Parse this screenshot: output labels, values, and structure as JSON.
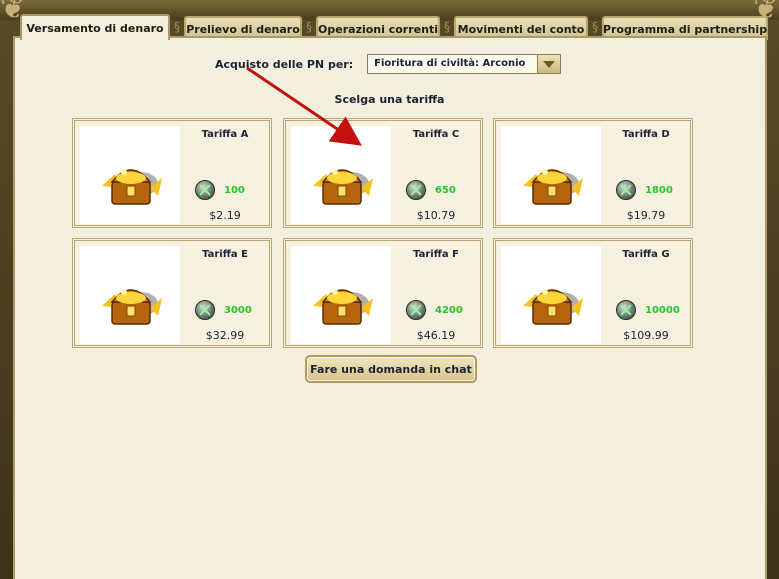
{
  "tabs": [
    {
      "label": "Versamento di denaro",
      "active": true
    },
    {
      "label": "Prelievo di denaro",
      "active": false
    },
    {
      "label": "Operazioni correnti",
      "active": false
    },
    {
      "label": "Movimenti del conto",
      "active": false
    },
    {
      "label": "Programma di partnership",
      "active": false
    }
  ],
  "purchase": {
    "label": "Acquisto delle PN per:",
    "selected": "Fioritura di civiltà: Arconio"
  },
  "choose_title": "Scelga una tariffa",
  "tariffs": [
    {
      "name": "Tariffa A",
      "amount": "100",
      "price": "$2.19"
    },
    {
      "name": "Tariffa C",
      "amount": "650",
      "price": "$10.79"
    },
    {
      "name": "Tariffa D",
      "amount": "1800",
      "price": "$19.79"
    },
    {
      "name": "Tariffa E",
      "amount": "3000",
      "price": "$32.99"
    },
    {
      "name": "Tariffa F",
      "amount": "4200",
      "price": "$46.19"
    },
    {
      "name": "Tariffa G",
      "amount": "10000",
      "price": "$109.99"
    }
  ],
  "chat_button": "Fare una domanda in chat",
  "colors": {
    "panel_bg": "#f3efdf",
    "amount_green": "#29c42c",
    "arrow_red": "#c4100e"
  },
  "icons": {
    "treasure": "treasure-chest-icon",
    "coin": "pn-coin-icon",
    "dropdown": "chevron-down-icon"
  }
}
